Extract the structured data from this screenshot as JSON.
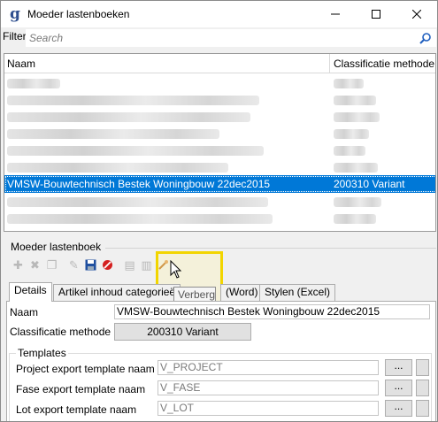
{
  "window": {
    "title": "Moeder lastenboeken"
  },
  "filter": {
    "label": "Filter",
    "placeholder": "Search"
  },
  "grid": {
    "columns": [
      "Naam",
      "Classificatie methode"
    ],
    "rows": [
      {
        "name": "VMSW-Bouwtechnisch Bestek Woningbouw 22dec2015",
        "method": "200310 Variant",
        "selected": true
      }
    ]
  },
  "panel": {
    "title": "Moeder lastenboek",
    "toolbar": [
      "add-icon",
      "delete-icon",
      "copy-icon",
      "edit-icon",
      "save-icon",
      "cancel-icon",
      "doc-icon",
      "doc2-icon",
      "hide-icon"
    ],
    "tooltip": "Verberg",
    "tabs": [
      "Details",
      "Artikel inhoud categorieë",
      "(Word)",
      "Stylen (Excel)"
    ],
    "details": {
      "naam_label": "Naam",
      "naam_value": "VMSW-Bouwtechnisch Bestek Woningbouw 22dec2015",
      "methode_label": "Classificatie methode",
      "methode_value": "200310 Variant",
      "templates_title": "Templates",
      "templates": [
        {
          "label": "Project export template naam",
          "value": "V_PROJECT",
          "button": "..."
        },
        {
          "label": "Fase export template naam",
          "value": "V_FASE",
          "button": "..."
        },
        {
          "label": "Lot export template naam",
          "value": "V_LOT",
          "button": "..."
        }
      ]
    }
  },
  "colors": {
    "selection": "#0078d7",
    "highlight": "#f2d500"
  }
}
